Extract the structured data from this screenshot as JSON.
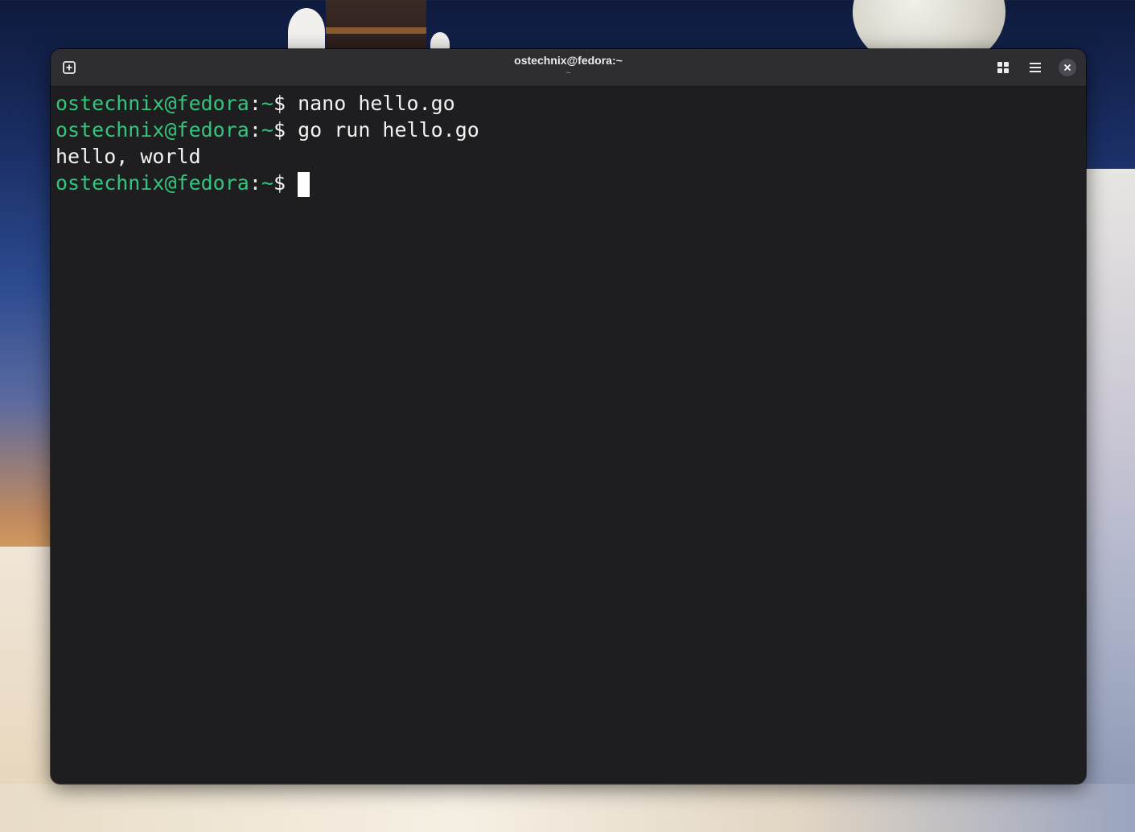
{
  "window": {
    "title": "ostechnix@fedora:~",
    "subtitle": "~"
  },
  "headerbar": {
    "new_tab_icon": "new-tab-plus-icon",
    "tab_overview_icon": "grid-icon",
    "menu_icon": "hamburger-menu-icon",
    "close_icon": "close-x-icon"
  },
  "terminal": {
    "lines": [
      {
        "type": "prompt",
        "user_host": "ostechnix@fedora",
        "sep": ":",
        "path": "~",
        "symbol": "$ ",
        "command": "nano hello.go"
      },
      {
        "type": "prompt",
        "user_host": "ostechnix@fedora",
        "sep": ":",
        "path": "~",
        "symbol": "$ ",
        "command": "go run hello.go"
      },
      {
        "type": "output",
        "text": "hello, world"
      },
      {
        "type": "prompt",
        "user_host": "ostechnix@fedora",
        "sep": ":",
        "path": "~",
        "symbol": "$ ",
        "command": ""
      }
    ]
  },
  "colors": {
    "prompt_green": "#33c57c",
    "terminal_bg": "#1e1e20",
    "headerbar_bg": "#2e2e32",
    "text": "#f2f2f2"
  }
}
